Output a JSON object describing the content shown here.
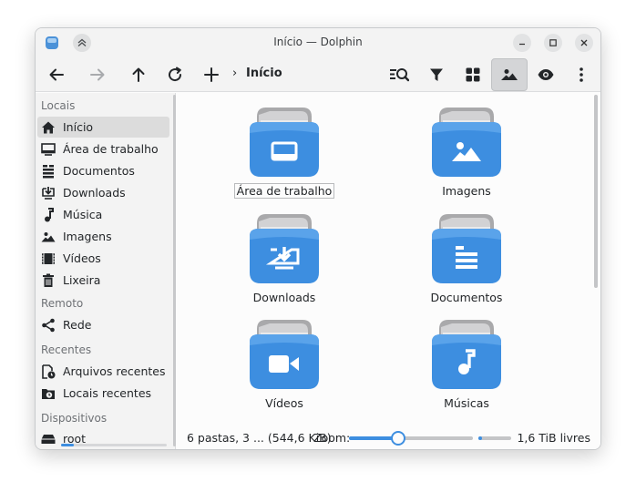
{
  "window": {
    "title": "Início — Dolphin"
  },
  "toolbar": {
    "breadcrumb_sep": "›",
    "location": "Início"
  },
  "sidebar": {
    "sections": [
      {
        "heading": "Locais",
        "items": [
          {
            "label": "Início",
            "icon": "home-icon"
          },
          {
            "label": "Área de trabalho",
            "icon": "desktop-icon"
          },
          {
            "label": "Documentos",
            "icon": "documents-icon"
          },
          {
            "label": "Downloads",
            "icon": "downloads-icon"
          },
          {
            "label": "Música",
            "icon": "music-icon"
          },
          {
            "label": "Imagens",
            "icon": "images-icon"
          },
          {
            "label": "Vídeos",
            "icon": "videos-icon"
          },
          {
            "label": "Lixeira",
            "icon": "trash-icon"
          }
        ]
      },
      {
        "heading": "Remoto",
        "items": [
          {
            "label": "Rede",
            "icon": "network-icon"
          }
        ]
      },
      {
        "heading": "Recentes",
        "items": [
          {
            "label": "Arquivos recentes",
            "icon": "recent-files-icon"
          },
          {
            "label": "Locais recentes",
            "icon": "recent-locations-icon"
          }
        ]
      },
      {
        "heading": "Dispositivos",
        "items": [
          {
            "label": "root",
            "icon": "drive-icon",
            "usage_fraction": 0.12
          }
        ]
      }
    ]
  },
  "folders": [
    {
      "label": "Área de trabalho",
      "icon": "desktop-folder-icon"
    },
    {
      "label": "Imagens",
      "icon": "images-folder-icon"
    },
    {
      "label": "Downloads",
      "icon": "downloads-folder-icon"
    },
    {
      "label": "Documentos",
      "icon": "documents-folder-icon"
    },
    {
      "label": "Vídeos",
      "icon": "videos-folder-icon"
    },
    {
      "label": "Músicas",
      "icon": "music-folder-icon"
    }
  ],
  "statusbar": {
    "summary": "6 pastas, 3 ... (544,6 KiB)",
    "zoom_label": "Zoom:",
    "zoom_fraction": 0.4,
    "space_used_fraction": 0.12,
    "free_space": "1,6 TiB livres"
  },
  "colors": {
    "accent": "#3d8ee0",
    "folder_blue": "#3d8ee0",
    "folder_tab": "#a9a9ab"
  }
}
